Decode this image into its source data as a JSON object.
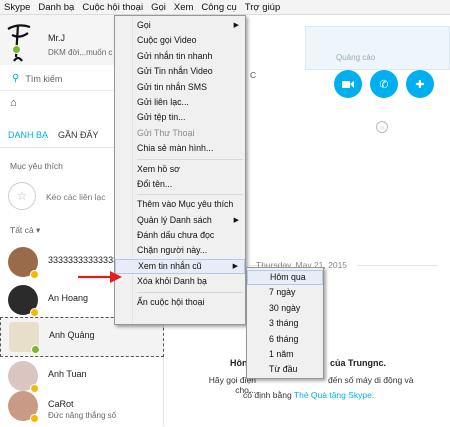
{
  "menubar": [
    "Skype",
    "Danh bạ",
    "Cuộc hội thoại",
    "Gọi",
    "Xem",
    "Công cụ",
    "Trợ giúp"
  ],
  "profile": {
    "name": "Mr.J",
    "mood": "DKM đời...muốn c"
  },
  "search": {
    "placeholder": "Tìm kiếm"
  },
  "tabs": {
    "contacts": "DANH BẠ",
    "recent": "GẦN ĐÂY"
  },
  "favorites": {
    "heading": "Mục yêu thích",
    "drag_hint": "Kéo các liên lạc"
  },
  "all_label": "Tất cả ▾",
  "contacts": [
    {
      "name": "3333333333333333",
      "mood": "",
      "status_color": "#f7b801"
    },
    {
      "name": "An Hoang",
      "mood": "",
      "status_color": "#f7b801"
    },
    {
      "name": "Anh Quảng",
      "mood": "",
      "status_color": "#7ab82b"
    },
    {
      "name": "Anh Tuan",
      "mood": "",
      "status_color": "#f7b801"
    },
    {
      "name": "CaRot",
      "mood": "Đức năng thắng số",
      "status_color": "#f7b801"
    }
  ],
  "banner": {
    "text": "Quảng cáo"
  },
  "conversation": {
    "header_partial": "C",
    "date": "Thursday, May 21, 2015",
    "welcome_left": "Hôn",
    "welcome_right": "của Trungnc.",
    "hint_line1": "Hãy gọi điện cho...",
    "hint_line1_right": "đến số máy di động và",
    "hint_line2": "cố định bằng",
    "hint_link": "Thẻ Quà tặng Skype",
    "hint_end": "."
  },
  "context_menu": [
    {
      "label": "Gọi",
      "submenu": true
    },
    {
      "label": "Cuộc gọi Video"
    },
    {
      "label": "Gửi nhắn tin nhanh"
    },
    {
      "label": "Gửi Tin nhắn Video"
    },
    {
      "label": "Gửi tin nhắn SMS"
    },
    {
      "label": "Gửi liên lạc..."
    },
    {
      "label": "Gửi tệp tin..."
    },
    {
      "label": "Gửi Thư Thoại",
      "disabled": true
    },
    {
      "label": "Chia sẻ màn hình..."
    },
    {
      "sep": true
    },
    {
      "label": "Xem hồ sơ"
    },
    {
      "label": "Đổi tên..."
    },
    {
      "sep": true
    },
    {
      "label": "Thêm vào Mục yêu thích"
    },
    {
      "label": "Quản lý Danh sách",
      "submenu": true
    },
    {
      "label": "Đánh dấu chưa đọc"
    },
    {
      "label": "Chặn người này..."
    },
    {
      "label": "Xem tin nhắn cũ",
      "submenu": true,
      "highlighted": true
    },
    {
      "label": "Xóa khỏi Danh bạ"
    },
    {
      "sep": true
    },
    {
      "label": "Ẩn cuộc hội thoại"
    }
  ],
  "history_submenu": [
    {
      "label": "Hôm qua",
      "highlighted": true
    },
    {
      "label": "7 ngày"
    },
    {
      "label": "30 ngày"
    },
    {
      "label": "3 tháng"
    },
    {
      "label": "6 tháng"
    },
    {
      "label": "1 năm"
    },
    {
      "label": "Từ đầu"
    }
  ],
  "colors": {
    "skype_blue": "#00aff0",
    "online": "#7ab82b",
    "away": "#f7b801",
    "arrow": "#e02020"
  }
}
